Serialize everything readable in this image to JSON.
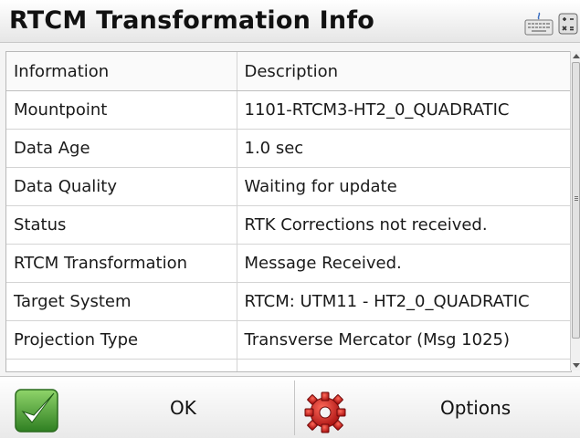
{
  "window": {
    "title": "RTCM Transformation Info"
  },
  "toolbar": {
    "keyboard_icon": "keyboard-icon",
    "calculator_icon": "calculator-icon"
  },
  "table": {
    "headers": [
      "Information",
      "Description"
    ],
    "rows": [
      [
        "Mountpoint",
        "1101-RTCM3-HT2_0_QUADRATIC"
      ],
      [
        "Data Age",
        "1.0 sec"
      ],
      [
        "Data Quality",
        "Waiting for update"
      ],
      [
        "Status",
        "RTK Corrections not received."
      ],
      [
        "RTCM Transformation",
        "Message Received."
      ],
      [
        "Target System",
        "RTCM: UTM11 - HT2_0_QUADRATIC"
      ],
      [
        "Projection Type",
        "Transverse Mercator (Msg 1025)"
      ],
      [
        "",
        ""
      ]
    ]
  },
  "buttons": {
    "ok_label": "OK",
    "options_label": "Options"
  },
  "colors": {
    "ok_green": "#3f9a2f",
    "options_red": "#d21f1f"
  }
}
